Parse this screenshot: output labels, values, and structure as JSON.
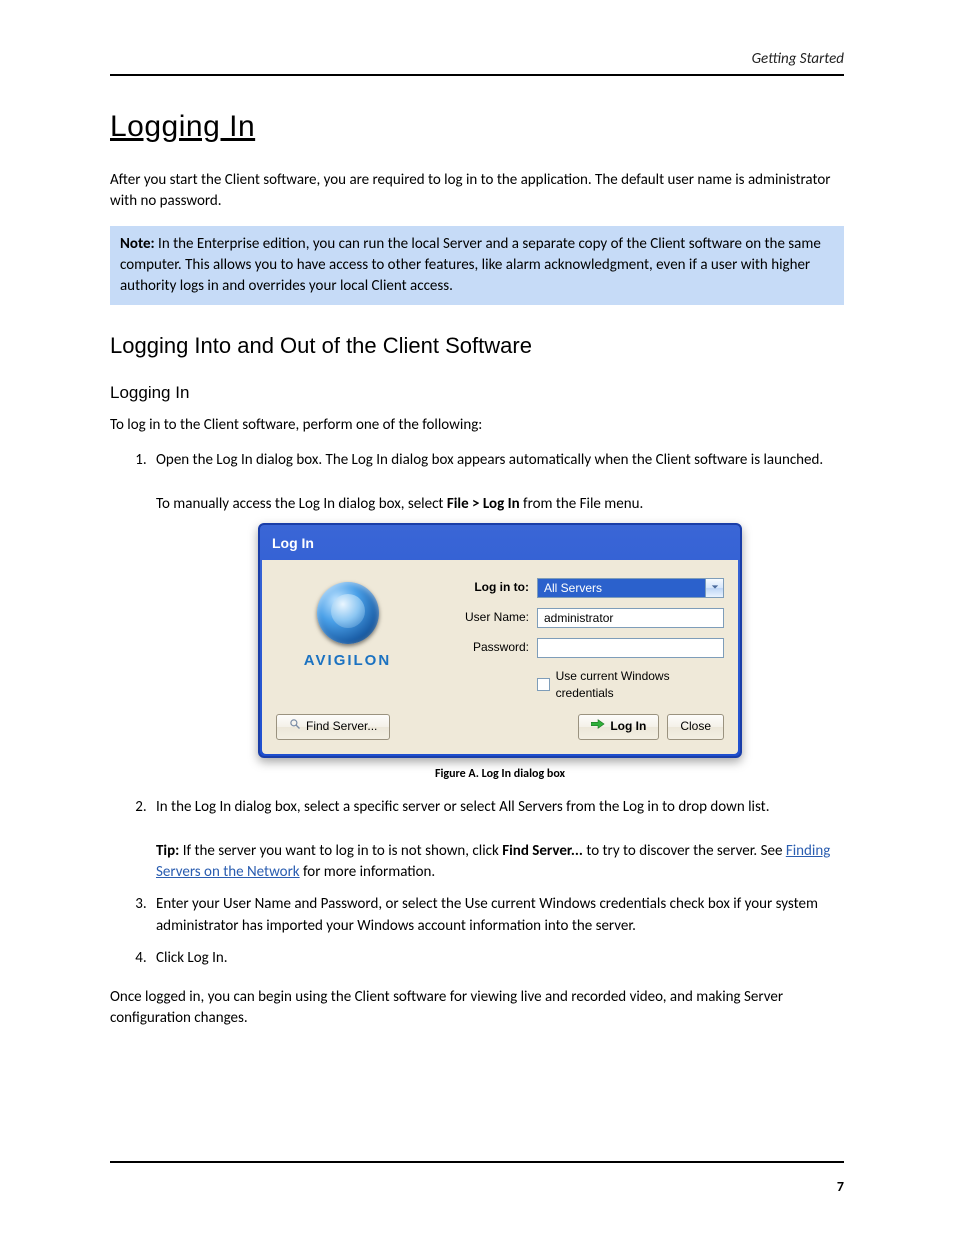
{
  "runningHead": "Getting Started",
  "title": "Logging In",
  "intro": "After you start the Client software, you are required to log in to the application. The default user name is administrator with no password.",
  "note": {
    "label": "Note:",
    "text": " In the Enterprise edition, you can run the local Server and a separate copy of the Client software on the same computer. This allows you to have access to other features, like alarm acknowledgment, even if a user with higher authority logs in and overrides your local Client access."
  },
  "h2": "Logging Into and Out of the Client Software",
  "para_connect": "To log in to the Client software, perform one of the following:",
  "h3_login": "Logging In",
  "step1_a": "Open the Log In dialog box. The Log In dialog box appears automatically when the Client software is launched.",
  "step1_b": "To manually access the Log In dialog box, select ",
  "step1_c": " from the File menu.",
  "menu_login": "File > Log In",
  "dialog": {
    "title": "Log In",
    "brand": "AVIGILON",
    "labels": {
      "login_to": "Log in to:",
      "user": "User Name:",
      "pass": "Password:",
      "cred": "Use current Windows credentials"
    },
    "values": {
      "login_to": "All Servers",
      "user": "administrator",
      "pass": ""
    },
    "buttons": {
      "find": "Find Server...",
      "login": "Log In",
      "close": "Close"
    }
  },
  "caption": "Figure A. Log In dialog box",
  "step2": "In the Log In dialog box, select a specific server or select All Servers from the Log in to drop down list.",
  "tip": {
    "label": "Tip:",
    "a": " If the server you want to log in to is not shown, click ",
    "btn": "Find Server...",
    "b": " to try to discover the server. See ",
    "link": "Finding Servers on the Network",
    "c": " for more information."
  },
  "step3": "Enter your User Name and Password, or select the Use current Windows credentials check box if your system administrator has imported your Windows account information into the server.",
  "step4": "Click Log In.",
  "tail": "Once logged in, you can begin using the Client software for viewing live and recorded video, and making Server configuration changes.",
  "pageNum": "7"
}
